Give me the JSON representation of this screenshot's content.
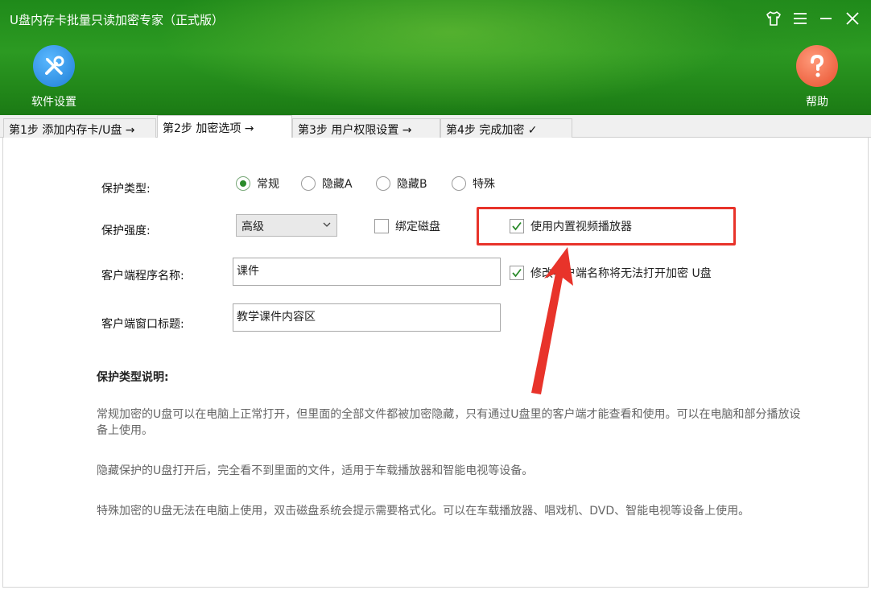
{
  "window": {
    "title": "U盘内存卡批量只读加密专家（正式版）",
    "controls": [
      "skin-icon",
      "menu-icon",
      "minimize-icon",
      "close-icon"
    ]
  },
  "toolbar": {
    "settings_label": "软件设置",
    "help_label": "帮助"
  },
  "tabs": [
    {
      "label": "第1步 添加内存卡/U盘 →",
      "active": false
    },
    {
      "label": "第2步 加密选项 →",
      "active": true
    },
    {
      "label": "第3步 用户权限设置 →",
      "active": false
    },
    {
      "label": "第4步 完成加密 ✓",
      "active": false
    }
  ],
  "form": {
    "protect_type_label": "保护类型:",
    "protect_types": [
      {
        "label": "常规",
        "selected": true
      },
      {
        "label": "隐藏A",
        "selected": false
      },
      {
        "label": "隐藏B",
        "selected": false
      },
      {
        "label": "特殊",
        "selected": false
      }
    ],
    "strength_label": "保护强度:",
    "strength_value": "高级",
    "bind_disk_label": "绑定磁盘",
    "bind_disk_checked": false,
    "builtin_player_label": "使用内置视频播放器",
    "builtin_player_checked": true,
    "client_name_label": "客户端程序名称:",
    "client_name_value": "课件",
    "rename_warning_label": "修改客户端名称将无法打开加密 U盘",
    "rename_warning_checked": true,
    "window_title_label": "客户端窗口标题:",
    "window_title_value": "教学课件内容区"
  },
  "description": {
    "title": "保护类型说明:",
    "p1": "常规加密的U盘可以在电脑上正常打开，但里面的全部文件都被加密隐藏，只有通过U盘里的客户端才能查看和使用。可以在电脑和部分播放设备上使用。",
    "p2": "隐藏保护的U盘打开后，完全看不到里面的文件，适用于车载播放器和智能电视等设备。",
    "p3": "特殊加密的U盘无法在电脑上使用，双击磁盘系统会提示需要格式化。可以在车载播放器、唱戏机、DVD、智能电视等设备上使用。"
  },
  "annotation": {
    "color": "#e8332a"
  }
}
